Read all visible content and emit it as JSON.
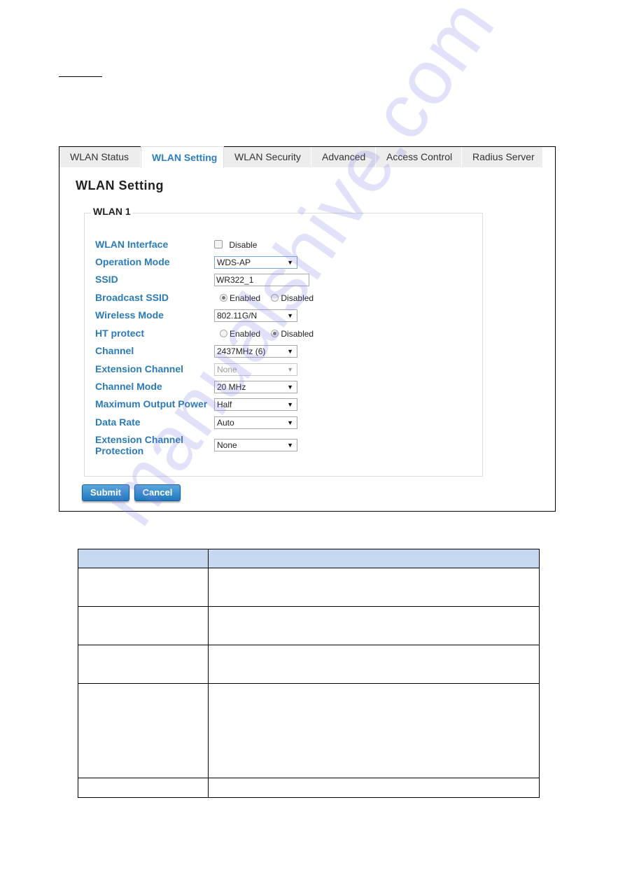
{
  "tabs": [
    {
      "label": "WLAN Status",
      "active": false
    },
    {
      "label": "WLAN Setting",
      "active": true
    },
    {
      "label": "WLAN Security",
      "active": false
    },
    {
      "label": "Advanced",
      "active": false
    },
    {
      "label": "Access Control",
      "active": false
    },
    {
      "label": "Radius Server",
      "active": false
    }
  ],
  "page_title": "WLAN Setting",
  "group_title": "WLAN 1",
  "fields": {
    "wlan_interface": {
      "label": "WLAN Interface",
      "checkbox_label": "Disable",
      "checked": false
    },
    "operation_mode": {
      "label": "Operation Mode",
      "value": "WDS-AP"
    },
    "ssid": {
      "label": "SSID",
      "value": "WR322_1"
    },
    "broadcast_ssid": {
      "label": "Broadcast SSID",
      "options": [
        "Enabled",
        "Disabled"
      ],
      "selected": "Enabled"
    },
    "wireless_mode": {
      "label": "Wireless Mode",
      "value": "802.11G/N"
    },
    "ht_protect": {
      "label": "HT protect",
      "options": [
        "Enabled",
        "Disabled"
      ],
      "selected": "Disabled"
    },
    "channel": {
      "label": "Channel",
      "value": "2437MHz (6)"
    },
    "extension_channel": {
      "label": "Extension Channel",
      "value": "None",
      "disabled": true
    },
    "channel_mode": {
      "label": "Channel Mode",
      "value": "20 MHz"
    },
    "max_output_power": {
      "label": "Maximum Output Power",
      "value": "Half"
    },
    "data_rate": {
      "label": "Data Rate",
      "value": "Auto"
    },
    "ext_channel_protection": {
      "label_line1": "Extension Channel",
      "label_line2": "Protection",
      "value": "None"
    }
  },
  "buttons": {
    "submit": "Submit",
    "cancel": "Cancel"
  },
  "icons": {
    "dropdown_arrow": "▼"
  },
  "watermark": "manualshive.com",
  "colors": {
    "label_blue": "#2b7bb9",
    "active_tab": "#2b7fbf",
    "table_header": "#c6d9f0"
  }
}
